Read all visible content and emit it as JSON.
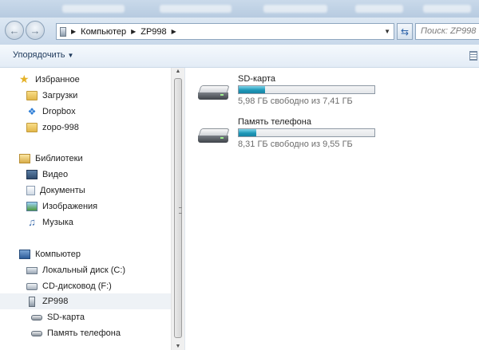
{
  "address_bar": {
    "crumbs": [
      "Компьютер",
      "ZP998"
    ],
    "search_placeholder": "Поиск: ZP998"
  },
  "toolbar": {
    "organize_label": "Упорядочить"
  },
  "sidebar": {
    "favorites": {
      "label": "Избранное",
      "items": [
        "Загрузки",
        "Dropbox",
        "zopo-998"
      ]
    },
    "libraries": {
      "label": "Библиотеки",
      "items": [
        "Видео",
        "Документы",
        "Изображения",
        "Музыка"
      ]
    },
    "computer": {
      "label": "Компьютер",
      "items": [
        "Локальный диск (C:)",
        "CD-дисковод (F:)",
        "ZP998"
      ],
      "selected": "ZP998",
      "subitems": [
        "SD-карта",
        "Память телефона"
      ]
    }
  },
  "drives": [
    {
      "name": "SD-карта",
      "free_text": "5,98 ГБ свободно из 7,41 ГБ",
      "used_fraction": 0.193
    },
    {
      "name": "Память телефона",
      "free_text": "8,31 ГБ свободно из 9,55 ГБ",
      "used_fraction": 0.13
    }
  ],
  "colors": {
    "bar_fill": "#1f98b8",
    "nav_gradient_top": "#dde8f3",
    "selected_bg": "#eef2f6"
  }
}
